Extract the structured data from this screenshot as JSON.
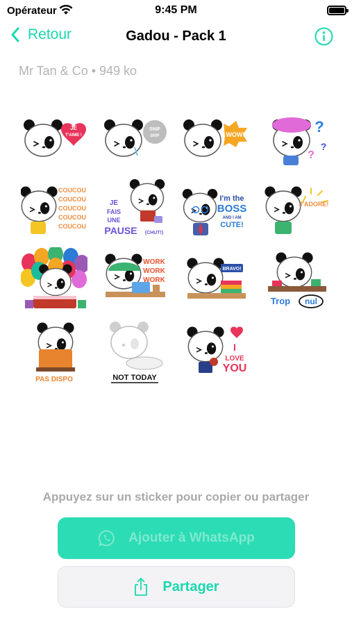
{
  "status_bar": {
    "carrier": "Opérateur",
    "time": "9:45 PM"
  },
  "nav": {
    "back_label": "Retour",
    "title": "Gadou - Pack 1"
  },
  "pack": {
    "meta": "Mr Tan & Co • 949 ko"
  },
  "stickers": [
    {
      "name": "sticker-je-taime",
      "text": [
        "JE",
        "T'AIME !"
      ]
    },
    {
      "name": "sticker-snif",
      "text": [
        "SNIF",
        "SNIF"
      ]
    },
    {
      "name": "sticker-wow",
      "text": [
        "WOW!"
      ]
    },
    {
      "name": "sticker-question",
      "text": [
        "?"
      ]
    },
    {
      "name": "sticker-coucou",
      "text": [
        "COUCOU",
        "COUCOU",
        "COUCOU",
        "COUCOU",
        "COUCOU"
      ]
    },
    {
      "name": "sticker-pause",
      "text": [
        "JE",
        "FAIS",
        "UNE",
        "PAUSE",
        "(CHUT!)"
      ]
    },
    {
      "name": "sticker-boss",
      "text": [
        "I'm the",
        "BOSS",
        "AND I AM",
        "CUTE!"
      ]
    },
    {
      "name": "sticker-jadore",
      "text": [
        "J'ADORE!"
      ]
    },
    {
      "name": "sticker-balloons",
      "text": []
    },
    {
      "name": "sticker-work",
      "text": [
        "WORK",
        "WORK",
        "WORK"
      ]
    },
    {
      "name": "sticker-bravo",
      "text": [
        "BRAVO!"
      ]
    },
    {
      "name": "sticker-trop-nul",
      "text": [
        "Trop",
        "nul"
      ]
    },
    {
      "name": "sticker-pas-dispo",
      "text": [
        "PAS DISPO"
      ]
    },
    {
      "name": "sticker-not-today",
      "text": [
        "NOT TODAY"
      ]
    },
    {
      "name": "sticker-i-love-you",
      "text": [
        "I",
        "LOVE",
        "YOU"
      ]
    }
  ],
  "hint": "Appuyez sur un sticker pour copier ou partager",
  "buttons": {
    "whatsapp": "Ajouter à WhatsApp",
    "share": "Partager"
  },
  "colors": {
    "accent": "#1ad8ae",
    "whatsapp_button": "#2bdcb4",
    "meta_text": "#b4b4b4"
  },
  "icons": {
    "back": "chevron-left-icon",
    "info": "info-circle-icon",
    "whatsapp": "whatsapp-icon",
    "share": "share-icon"
  }
}
